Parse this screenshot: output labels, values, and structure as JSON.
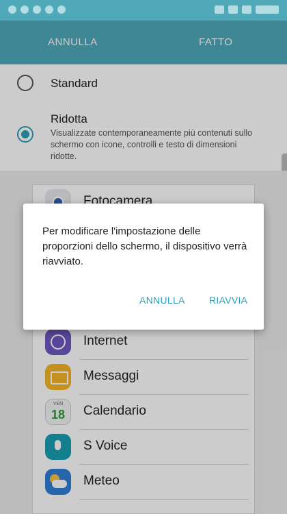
{
  "action_bar": {
    "cancel_label": "ANNULLA",
    "done_label": "FATTO"
  },
  "options": {
    "standard": {
      "title": "Standard",
      "selected": false
    },
    "ridotta": {
      "title": "Ridotta",
      "description": "Visualizzate contemporaneamente più contenuti sullo schermo con icone, controlli e testo di dimensioni ridotte.",
      "selected": true
    }
  },
  "preview": {
    "apps": [
      {
        "label": "Fotocamera",
        "icon": "camera-icon"
      },
      {
        "label": "Internet",
        "icon": "internet-icon"
      },
      {
        "label": "Messaggi",
        "icon": "messages-icon"
      },
      {
        "label": "Calendario",
        "icon": "calendar-icon",
        "day": "VEN",
        "date": "18"
      },
      {
        "label": "S Voice",
        "icon": "s-voice-icon"
      },
      {
        "label": "Meteo",
        "icon": "weather-icon"
      }
    ]
  },
  "dialog": {
    "message": "Per modificare l'impostazione delle proporzioni dello schermo, il dispositivo verrà riavviato.",
    "cancel_label": "ANNULLA",
    "restart_label": "RIAVVIA"
  },
  "colors": {
    "header": "#4fa9b9",
    "accent": "#2d9fb8"
  }
}
